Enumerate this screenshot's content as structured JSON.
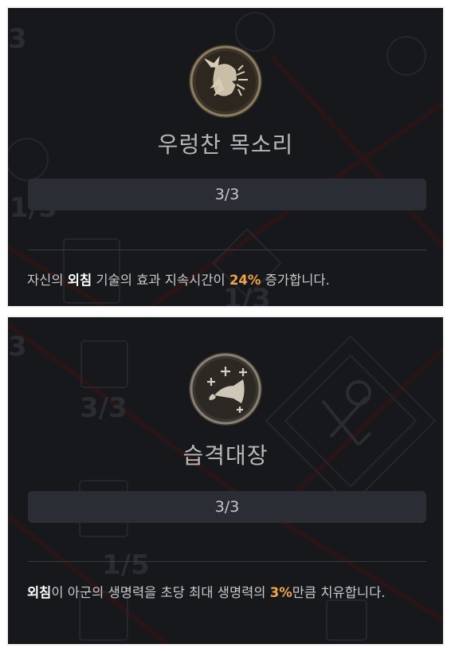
{
  "skills": [
    {
      "icon": "shouting-warrior-icon",
      "name": "우렁찬 목소리",
      "rank": "3/3",
      "description": {
        "pre": "자신의 ",
        "keyword": "외침",
        "mid": " 기술의 효과 지속시간이 ",
        "value": "24%",
        "post": " 증가합니다."
      }
    },
    {
      "icon": "war-horn-icon",
      "name": "습격대장",
      "rank": "3/3",
      "description": {
        "pre": "",
        "keyword": "외침",
        "mid": "이 아군의 생명력을 초당 최대 생명력의 ",
        "value": "3%",
        "post": "만큼 치유합니다."
      }
    }
  ],
  "background_ranks": [
    "3",
    "1/5",
    "1/3",
    "3",
    "3/3",
    "1/5"
  ],
  "colors": {
    "panel_bg": "#17181c",
    "rank_bar": "#2b2d34",
    "accent_value": "#f0a54a",
    "title_text": "#b9b9b9"
  }
}
